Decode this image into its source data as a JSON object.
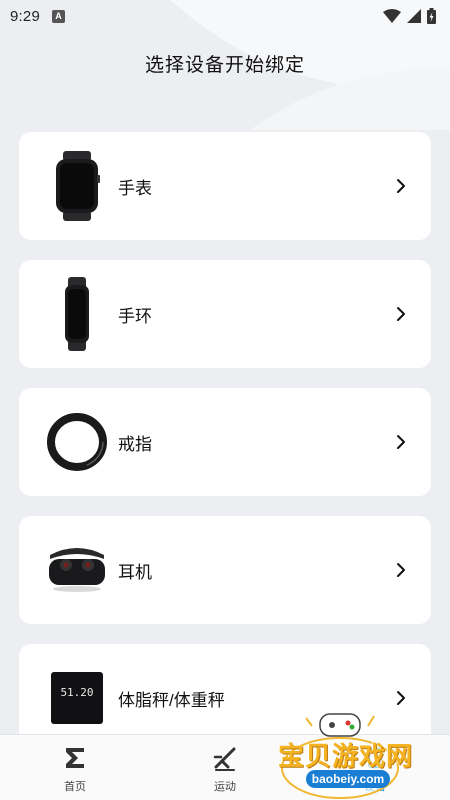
{
  "status_bar": {
    "time": "9:29",
    "notification_badge": "A"
  },
  "page_title": "选择设备开始绑定",
  "devices": [
    {
      "label": "手表",
      "icon": "smartwatch"
    },
    {
      "label": "手环",
      "icon": "fitness-band"
    },
    {
      "label": "戒指",
      "icon": "smart-ring"
    },
    {
      "label": "耳机",
      "icon": "earbuds"
    },
    {
      "label": "体脂秤/体重秤",
      "icon": "body-scale",
      "scale_readout": "51.20"
    }
  ],
  "bottom_nav": {
    "items": [
      {
        "label": "首页",
        "icon": "sigma-icon"
      },
      {
        "label": "运动",
        "icon": "run-icon"
      },
      {
        "label": "设备",
        "icon": "device-icon",
        "active": true
      }
    ]
  },
  "watermark": {
    "text": "宝贝游戏网",
    "url": "baobeiy.com"
  },
  "colors": {
    "accent": "#1a9bd7",
    "background": "#eceef2",
    "card": "#ffffff"
  }
}
